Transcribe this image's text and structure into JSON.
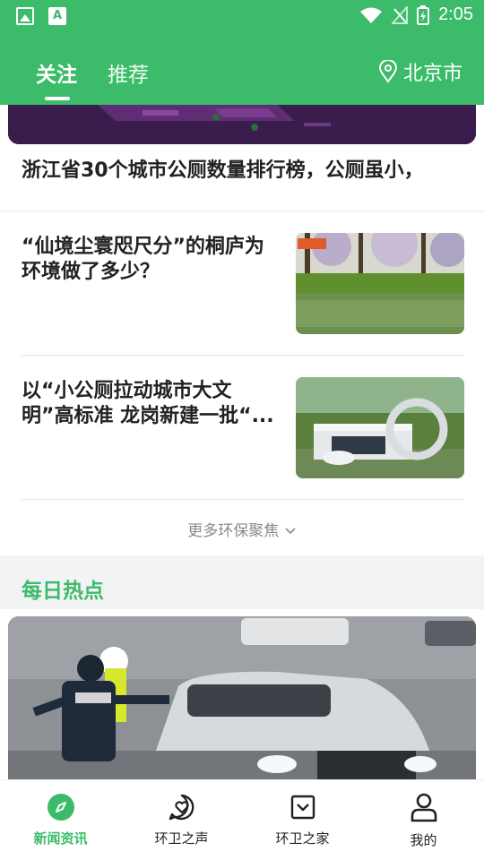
{
  "status_bar": {
    "time": "2:05"
  },
  "header": {
    "tabs": [
      {
        "label": "关注",
        "active": true
      },
      {
        "label": "推荐",
        "active": false
      }
    ],
    "city": "北京市"
  },
  "top_article": {
    "title": "浙江省30个城市公厕数量排行榜，公厕虽小，"
  },
  "news": [
    {
      "title": "“仙境尘寰咫尺分”的桐庐为环境做了多少？"
    },
    {
      "title": "以“小公厕拉动城市大文明”高标准 龙岗新建一批“..."
    }
  ],
  "more_link": "更多环保聚焦",
  "daily_hot": {
    "title": "每日热点"
  },
  "bottom_nav": [
    {
      "label": "新闻资讯",
      "icon": "compass-icon",
      "active": true
    },
    {
      "label": "环卫之声",
      "icon": "heart-chat-icon",
      "active": false
    },
    {
      "label": "环卫之家",
      "icon": "inbox-icon",
      "active": false
    },
    {
      "label": "我的",
      "icon": "user-icon",
      "active": false
    }
  ],
  "colors": {
    "brand": "#3cbb6a",
    "text": "#222222",
    "muted": "#8a8a8a"
  }
}
